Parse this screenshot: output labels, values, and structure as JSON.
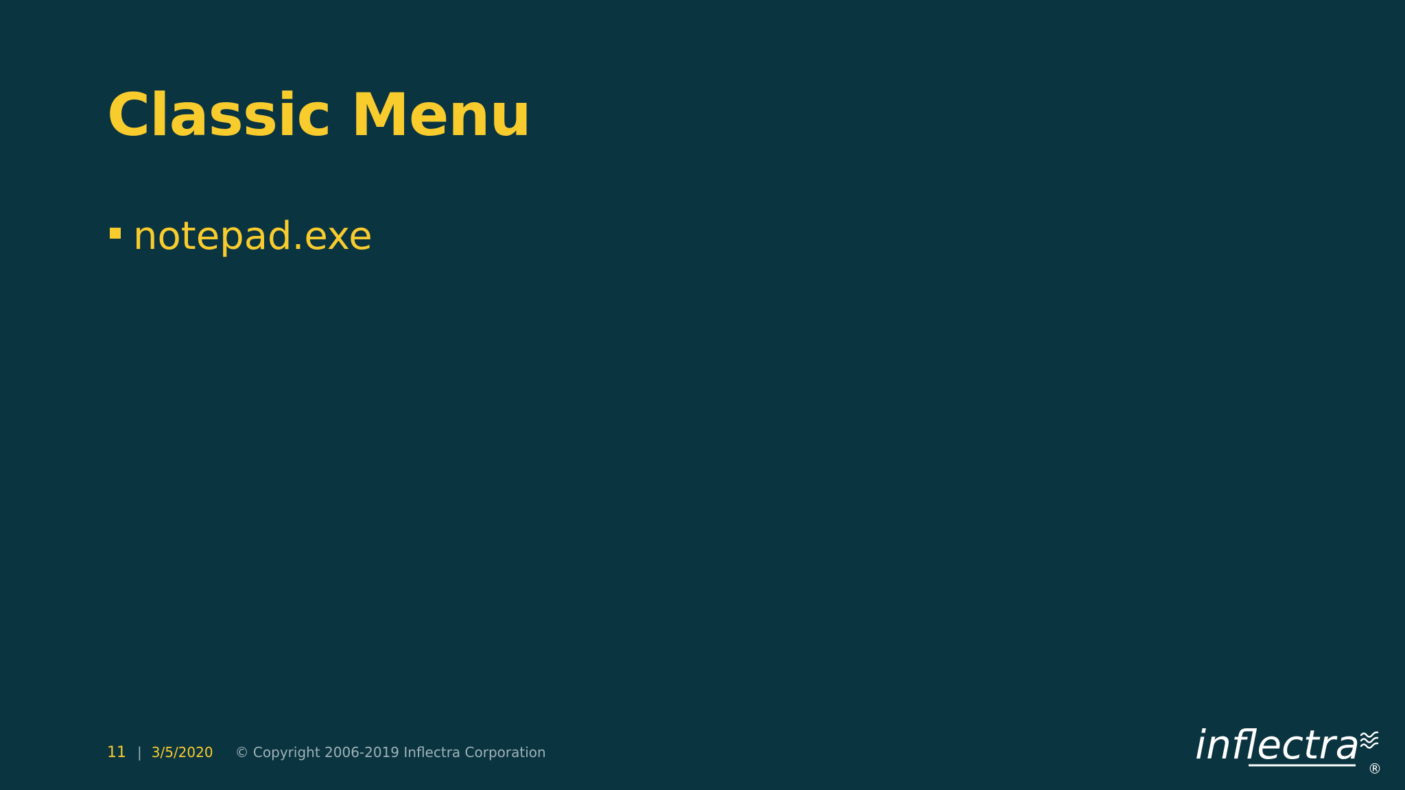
{
  "slide": {
    "title": "Classic Menu",
    "bullets": [
      "notepad.exe"
    ]
  },
  "footer": {
    "slide_number": "11",
    "separator": "|",
    "date": "3/5/2020",
    "copyright": "© Copyright 2006-2019 Inflectra Corporation"
  },
  "logo": {
    "text": "inflectra",
    "registered_mark": "®"
  },
  "colors": {
    "background": "#0a3440",
    "accent": "#f9cc2e",
    "muted_text": "#9fb3b8",
    "logo": "#ffffff"
  }
}
